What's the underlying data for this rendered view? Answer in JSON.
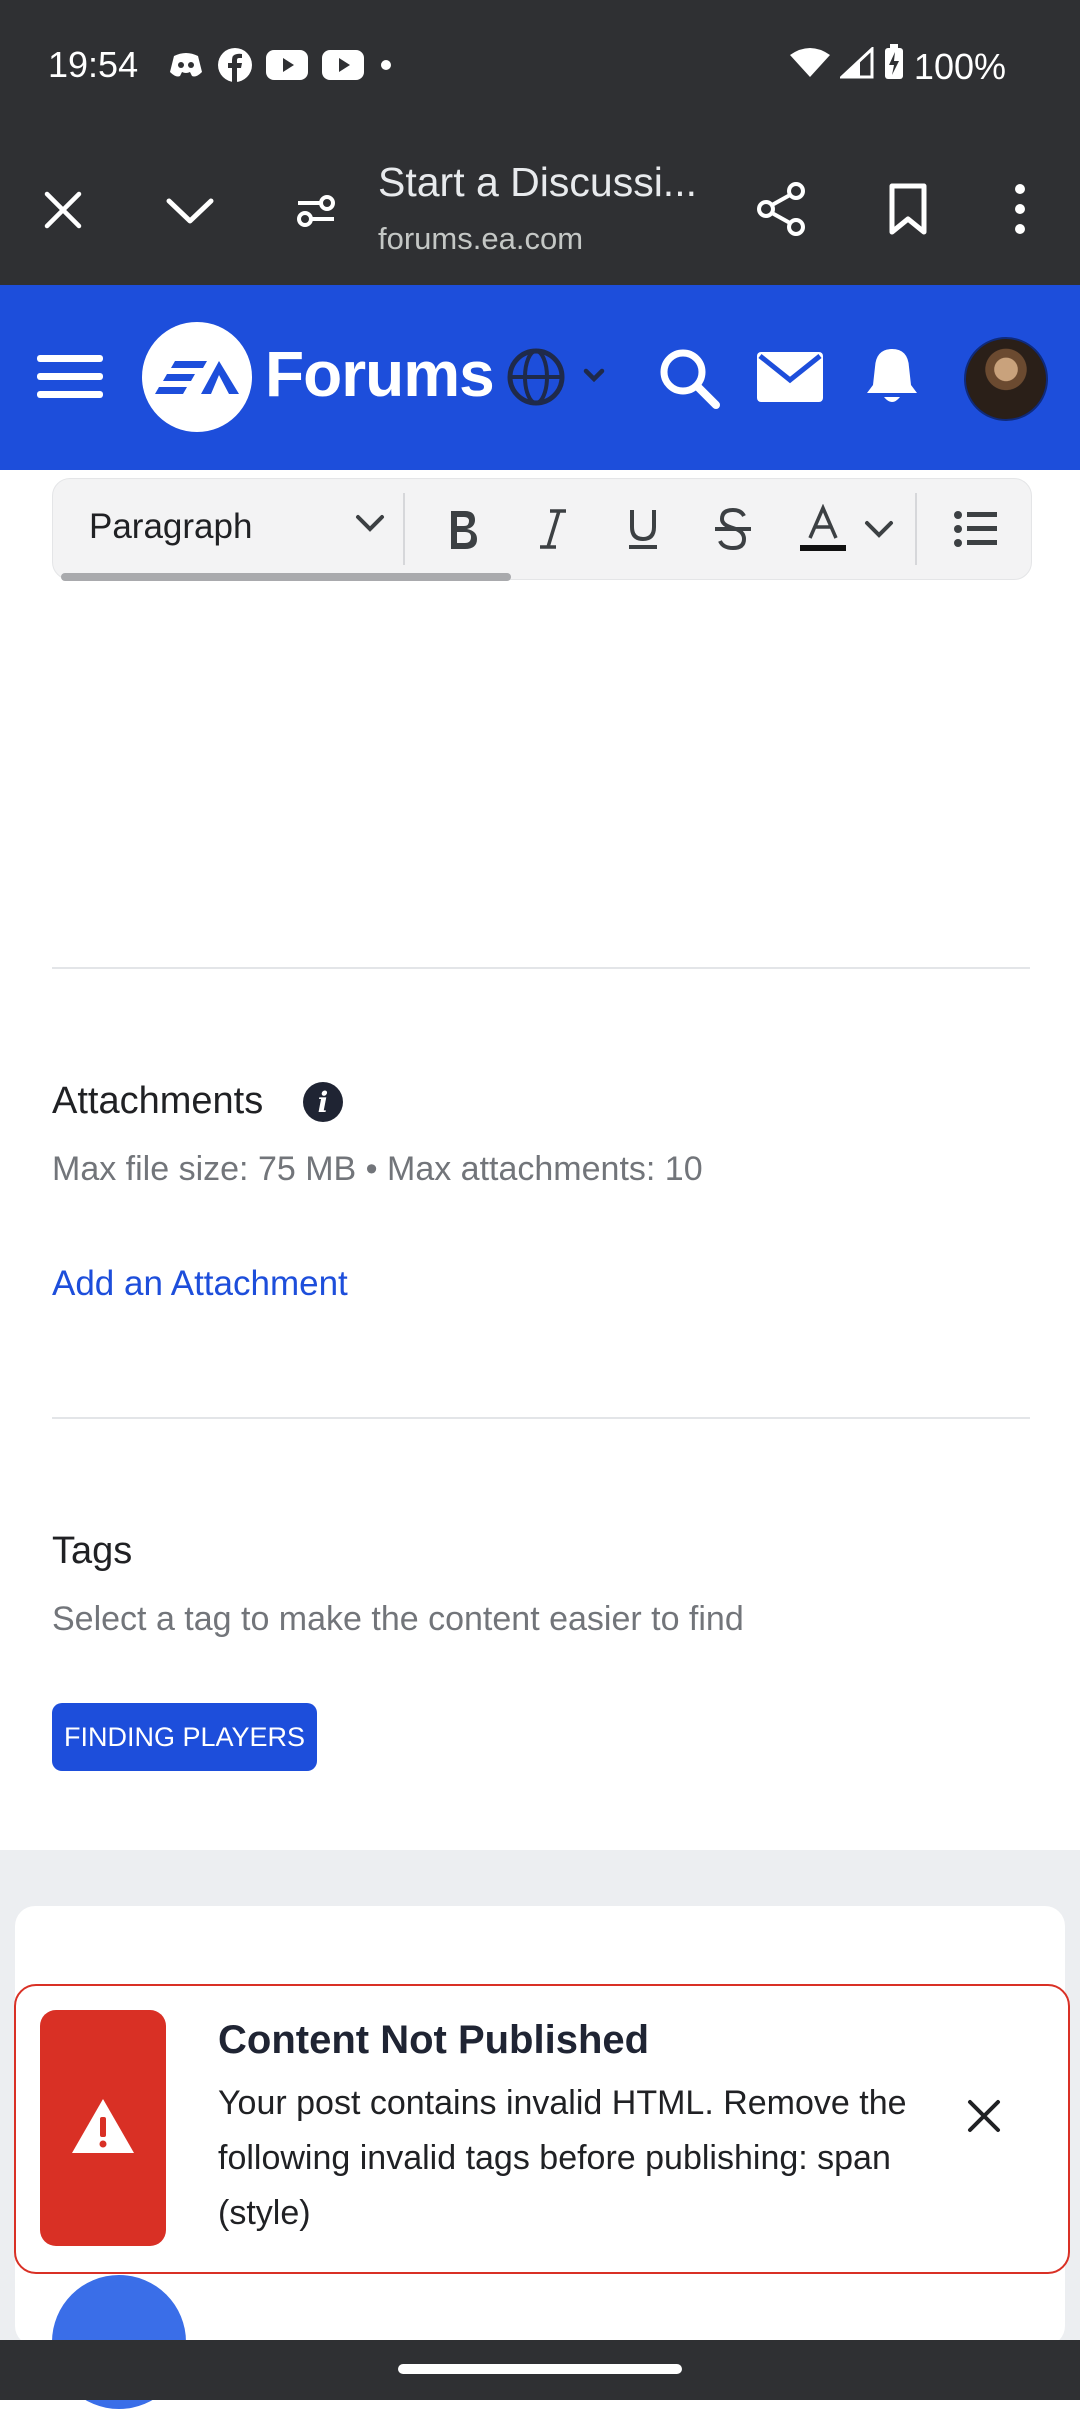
{
  "status_bar": {
    "time": "19:54",
    "battery": "100%",
    "notification_icons": [
      "discord-icon",
      "facebook-icon",
      "youtube-icon",
      "youtube-icon"
    ]
  },
  "browser": {
    "page_title": "Start a Discussi...",
    "url": "forums.ea.com"
  },
  "site": {
    "brand": "Forums",
    "brand_color": "#1d4edb"
  },
  "editor_toolbar": {
    "block_format": "Paragraph",
    "buttons": [
      "bold",
      "italic",
      "underline",
      "strikethrough",
      "text-color",
      "bulleted-list"
    ]
  },
  "attachments": {
    "title": "Attachments",
    "limits": "Max file size: 75 MB • Max attachments: 10",
    "add_link": "Add an Attachment"
  },
  "tags": {
    "title": "Tags",
    "hint": "Select a tag to make the content easier to find",
    "selected": "FINDING PLAYERS"
  },
  "toast": {
    "title": "Content Not Published",
    "message": "Your post contains invalid HTML. Remove the following invalid tags before publishing: span (style)",
    "accent_color": "#d93025"
  }
}
